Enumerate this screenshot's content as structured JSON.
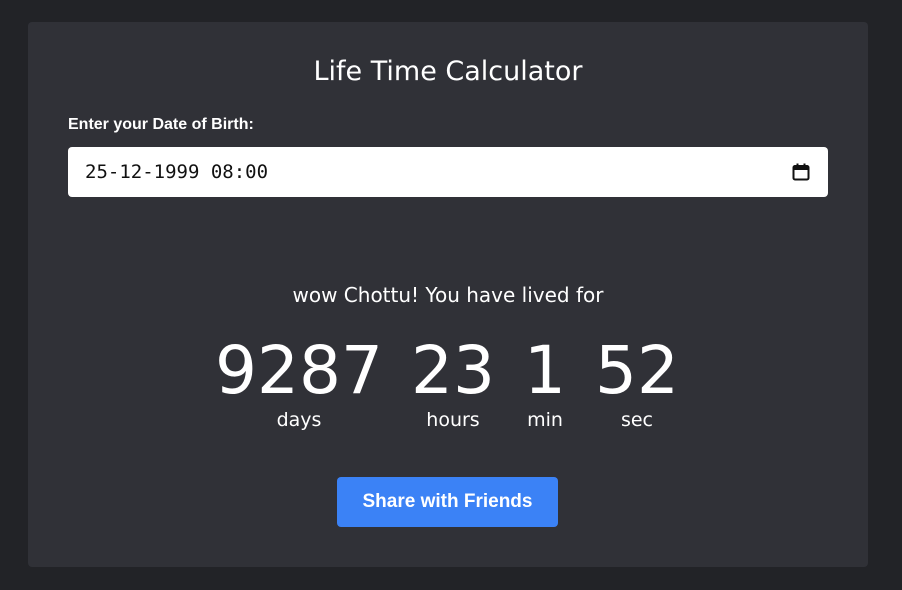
{
  "card": {
    "title": "Life Time Calculator",
    "dob_label": "Enter your Date of Birth:",
    "dob_value": "25-12-1999 08:00",
    "calendar_icon": "calendar-icon",
    "lived_message": "wow Chottu! You have lived for"
  },
  "counter": {
    "days": {
      "value": "9287",
      "label": "days"
    },
    "hours": {
      "value": "23",
      "label": "hours"
    },
    "min": {
      "value": "1",
      "label": "min"
    },
    "sec": {
      "value": "52",
      "label": "sec"
    }
  },
  "share_button": {
    "label": "Share with Friends"
  },
  "colors": {
    "page_background": "#222327",
    "card_background": "#303137",
    "accent": "#3b82f6",
    "text": "#ffffff"
  }
}
